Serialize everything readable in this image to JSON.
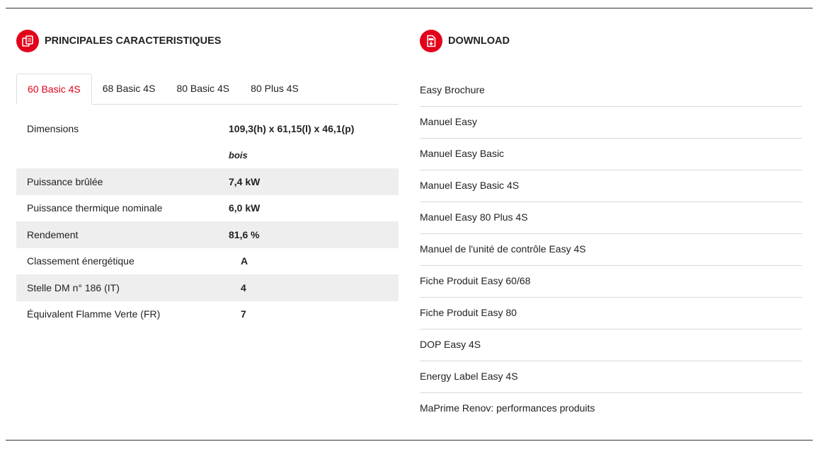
{
  "specs_section": {
    "title": "PRINCIPALES CARACTERISTIQUES",
    "icon": "copy-documents-icon",
    "tabs": [
      {
        "label": "60 Basic 4S",
        "active": true
      },
      {
        "label": "68 Basic 4S",
        "active": false
      },
      {
        "label": "80 Basic 4S",
        "active": false
      },
      {
        "label": "80 Plus 4S",
        "active": false
      }
    ],
    "rows": [
      {
        "label": "Dimensions",
        "value": "109,3(h) x 61,15(l) x 46,1(p)"
      },
      {
        "label": "",
        "value": "bois"
      },
      {
        "label": "Puissance brûlée",
        "value": "7,4 kW"
      },
      {
        "label": "Puissance thermique nominale",
        "value": "6,0 kW"
      },
      {
        "label": "Rendement",
        "value": "81,6 %"
      },
      {
        "label": "Classement énergétique",
        "value": "A"
      },
      {
        "label": "Stelle DM n° 186 (IT)",
        "value": "4"
      },
      {
        "label": "Équivalent Flamme Verte (FR)",
        "value": "7"
      }
    ]
  },
  "download_section": {
    "title": "DOWNLOAD",
    "icon": "pdf-download-icon",
    "items": [
      "Easy Brochure",
      "Manuel Easy",
      "Manuel Easy Basic",
      "Manuel Easy Basic 4S",
      "Manuel Easy 80 Plus 4S",
      "Manuel de l'unité de contrôle Easy 4S",
      "Fiche Produit Easy 60/68",
      "Fiche Produit Easy 80",
      "DOP Easy 4S",
      "Energy Label Easy 4S",
      "MaPrime Renov: performances produits"
    ]
  },
  "colors": {
    "accent": "#e2001a",
    "row_shade": "#eeeeee",
    "text": "#222222"
  }
}
